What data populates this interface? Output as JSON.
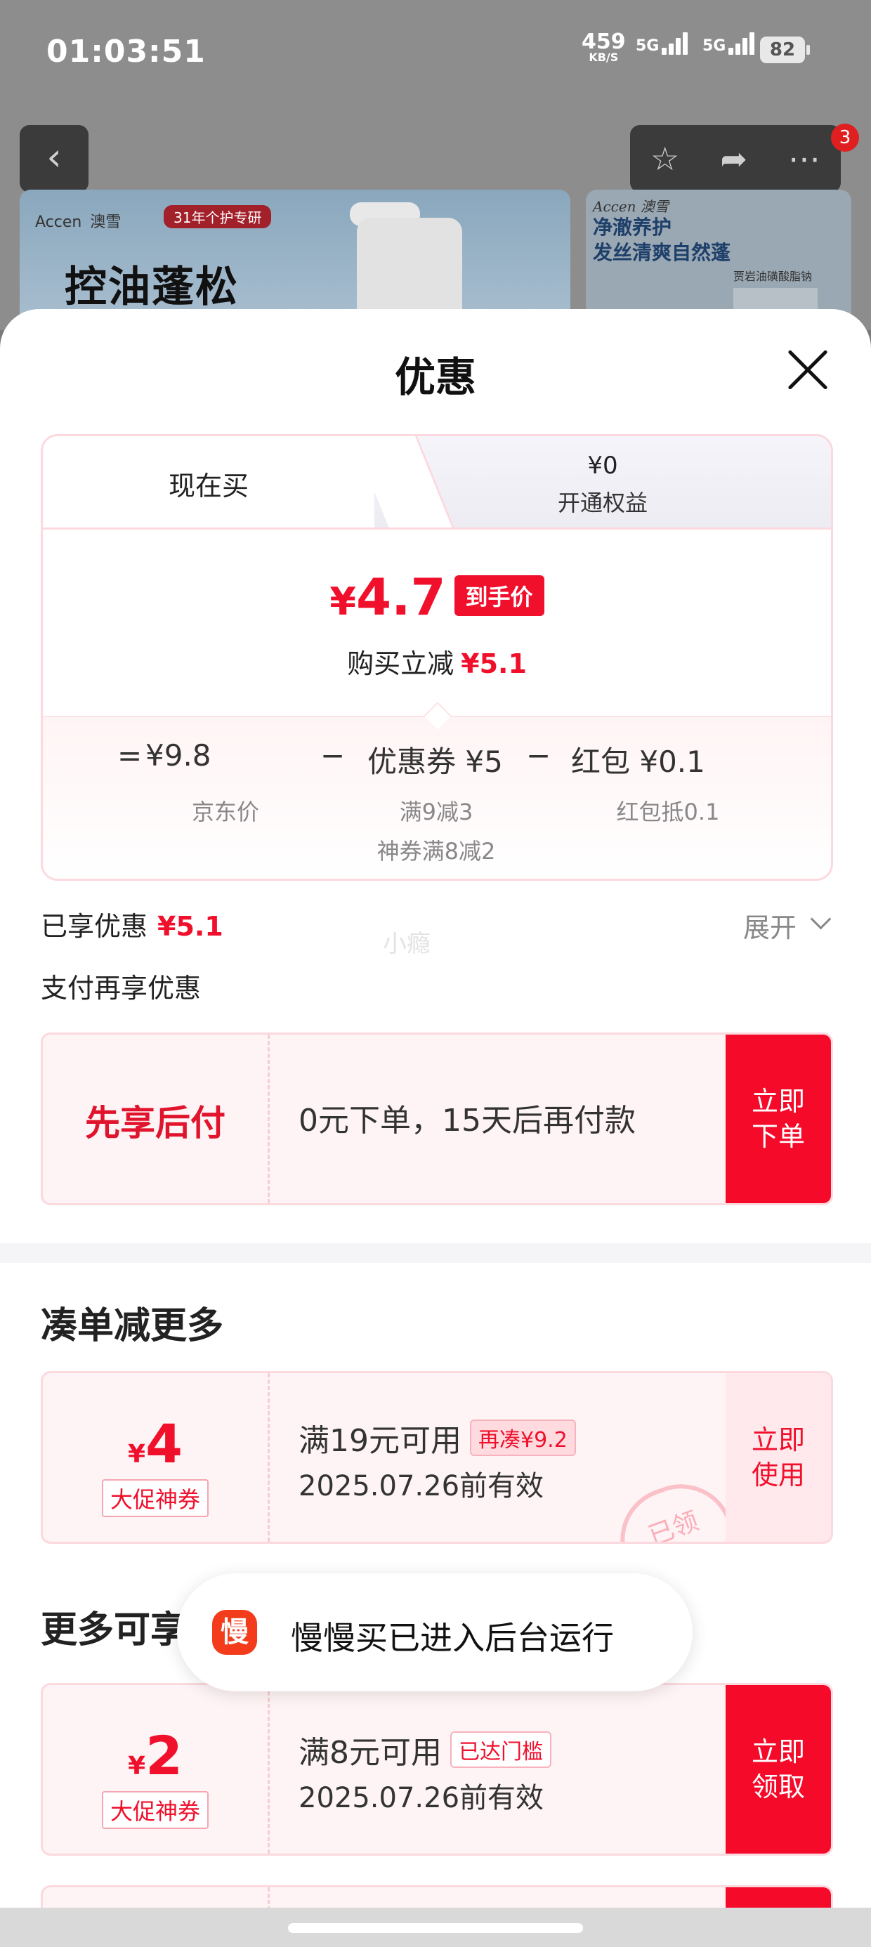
{
  "status_bar": {
    "time": "01:03:51",
    "net_speed": "459",
    "net_unit": "KB/S",
    "sim1": "5G",
    "sim2": "5G",
    "battery": "82"
  },
  "background_page": {
    "cart_badge": "3",
    "banner_brand": "Accen",
    "banner_brand_cn": "澳雪",
    "banner_tag": "31年个护专研",
    "banner_headline": "控油蓬松",
    "side_brand": "Accen 澳雪",
    "side_text_1": "净澈养护",
    "side_text_2": "发丝清爽自然蓬",
    "side_small": "贾岩油磺酸脂钠"
  },
  "sheet": {
    "title": "优惠",
    "tabs": {
      "active": "现在买",
      "inactive_price": "¥0",
      "inactive_label": "开通权益"
    },
    "price": {
      "yen": "¥",
      "value": "4.7",
      "badge": "到手价",
      "reduce_label": "购买立减",
      "reduce_value": "¥5.1"
    },
    "formula": {
      "eq": "=",
      "jd_price": "¥9.8",
      "minus1": "−",
      "coupon": "优惠券 ¥5",
      "minus2": "−",
      "redpack": "红包 ¥0.1",
      "jd_label": "京东价",
      "coupon_sub1": "满9减3",
      "coupon_sub2": "神券满8减2",
      "redpack_sub": "红包抵0.1"
    },
    "enjoyed_label": "已享优惠",
    "enjoyed_value": "¥5.1",
    "expand_label": "展开",
    "watermark": "小瘾",
    "pay_more_label": "支付再享优惠",
    "paylater": {
      "title": "先享后付",
      "desc": "0元下单，15天后再付款",
      "button": "立即下单"
    },
    "section_more": "凑单减更多",
    "coupon1": {
      "yen": "¥",
      "amount": "4",
      "tag": "大促神券",
      "condition": "满19元可用",
      "pill": "再凑¥9.2",
      "valid": "2025.07.26前有效",
      "button": "立即使用",
      "stamp": "已领"
    },
    "section_more2": "更多可享",
    "coupon2": {
      "yen": "¥",
      "amount": "2",
      "tag": "大促神券",
      "condition": "满8元可用",
      "pill": "已达门槛",
      "valid": "2025.07.26前有效",
      "button": "立即领取"
    }
  },
  "toast": {
    "icon_text": "慢",
    "text": "慢慢买已进入后台运行"
  }
}
